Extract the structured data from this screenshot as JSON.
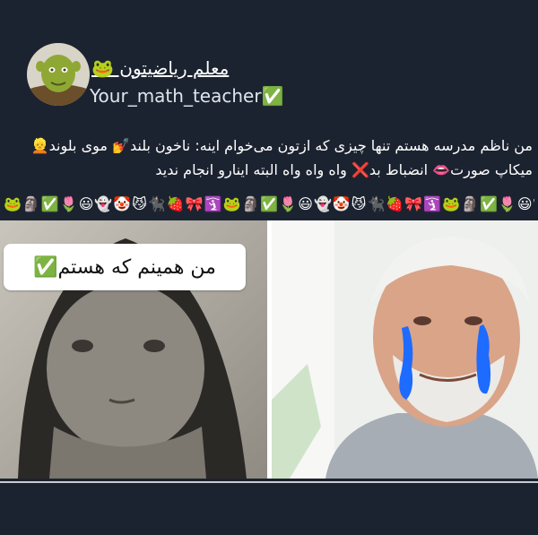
{
  "channel": {
    "name": "معلم ریاضیتون 🐸",
    "handle": "Your_math_teacher✅"
  },
  "post": {
    "caption": "من ناظم مدرسه  هستم تنها چیزی که ازتون می‌خوام اینه: ناخون بلند💅 موی بلوند👱 میکاپ صورت👄 انضباط بد❌ واه واه واه البته اینارو انجام ندید",
    "emoji_divider": "🐸🗿✅🌷😃👻🤡😼🐈‍⬛🍓🎀🛐🐸🗿✅🌷😃👻🤡😼🐈‍⬛🍓🎀🛐🐸🗿✅🌷😃👻🤡😼🐈‍⬛🍓🎀🛐"
  },
  "meme": {
    "caption_bubble": "من همینم که هستم✅"
  },
  "colors": {
    "background": "#1c2330",
    "tear_blue": "#1e6bff"
  }
}
